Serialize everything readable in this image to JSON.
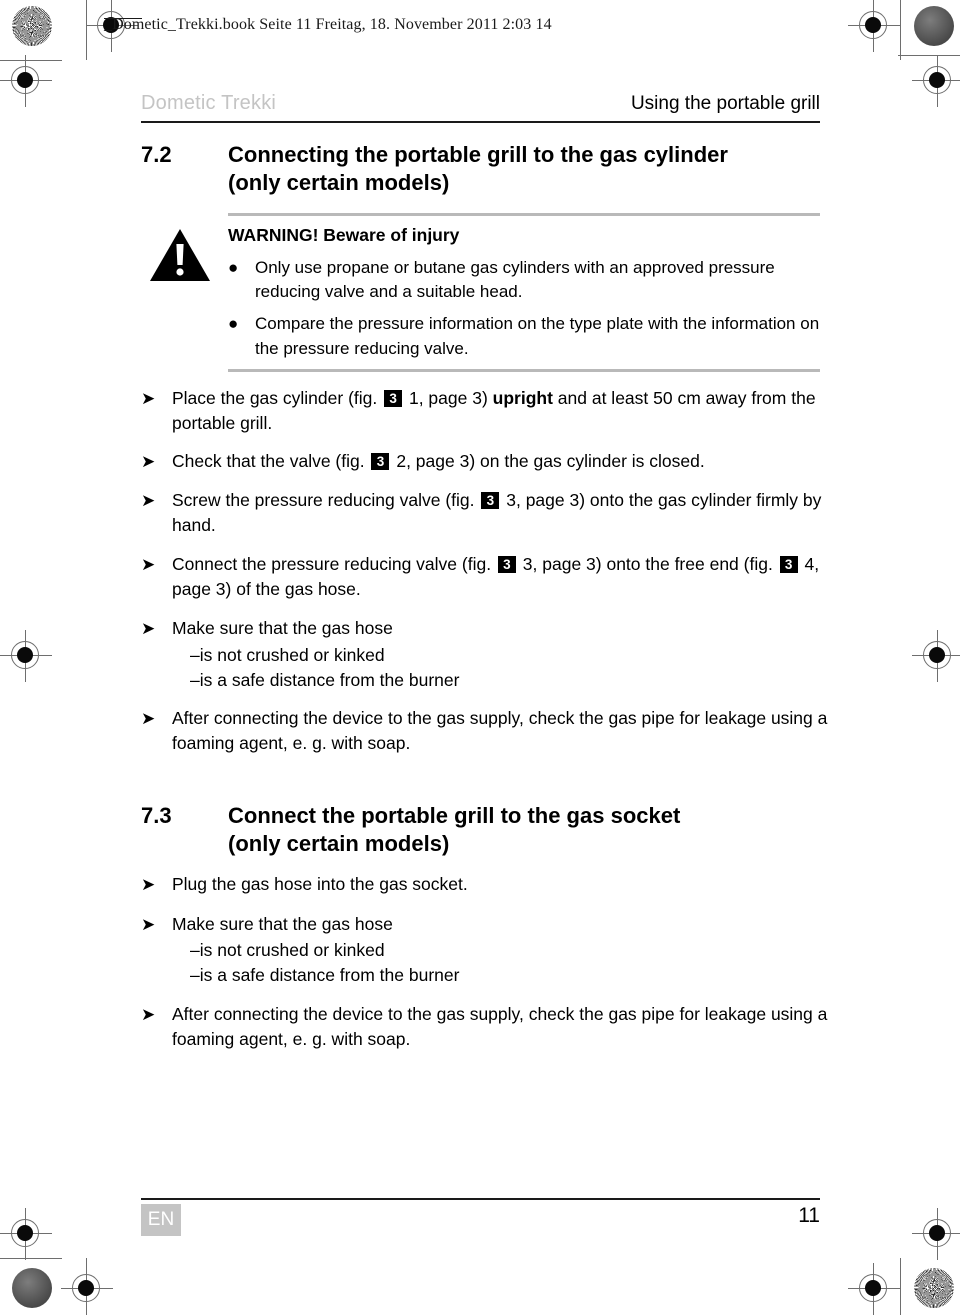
{
  "slug": {
    "text": "_Dometic_Trekki.book  Seite 11  Freitag, 18. November 2011  2:03 14"
  },
  "running_head": {
    "left": "Dometic Trekki",
    "right": "Using the portable grill",
    "left_color": "#c4c4c4"
  },
  "sections": [
    {
      "number": "7.2",
      "title_line1": "Connecting the portable grill to the gas cylinder",
      "title_line2": "(only certain models)"
    },
    {
      "number": "7.3",
      "title_line1": "Connect the portable grill to the gas socket",
      "title_line2": "(only certain models)"
    }
  ],
  "warning": {
    "icon": "warning-triangle-icon",
    "title": "WARNING! Beware of injury",
    "bullet_glyph": "●",
    "items": [
      "Only use propane or butane gas cylinders with an approved pressure reducing valve and a suitable head.",
      "Compare the pressure information on the type plate with the information on the pressure reducing valve."
    ]
  },
  "arrow_glyph": "➤",
  "dash_glyph": "–",
  "fig_badge_label": "3",
  "steps_72": [
    {
      "parts": [
        {
          "t": "text",
          "v": "Place the gas cylinder (fig. "
        },
        {
          "t": "badge",
          "v": "3"
        },
        {
          "t": "text",
          "v": " 1, page 3) "
        },
        {
          "t": "bold",
          "v": "upright"
        },
        {
          "t": "text",
          "v": " and at least 50 cm away from the portable grill."
        }
      ]
    },
    {
      "parts": [
        {
          "t": "text",
          "v": "Check that the valve (fig. "
        },
        {
          "t": "badge",
          "v": "3"
        },
        {
          "t": "text",
          "v": " 2, page 3) on the gas cylinder is closed."
        }
      ]
    },
    {
      "parts": [
        {
          "t": "text",
          "v": "Screw the pressure reducing valve (fig. "
        },
        {
          "t": "badge",
          "v": "3"
        },
        {
          "t": "text",
          "v": " 3, page 3) onto the gas cylinder firmly by hand."
        }
      ]
    },
    {
      "parts": [
        {
          "t": "text",
          "v": "Connect the pressure reducing valve (fig. "
        },
        {
          "t": "badge",
          "v": "3"
        },
        {
          "t": "text",
          "v": " 3, page 3) onto the free end (fig. "
        },
        {
          "t": "badge",
          "v": "3"
        },
        {
          "t": "text",
          "v": " 4, page 3) of the gas hose."
        }
      ]
    }
  ],
  "hose_check": {
    "lead": "Make sure that the gas hose",
    "sub_items": [
      "is not crushed or kinked",
      "is a safe distance from the burner"
    ]
  },
  "leak_check": "After connecting the device to the gas supply, check the gas pipe for leakage using a foaming agent, e. g. with soap.",
  "steps_73": [
    "Plug the gas hose into the gas socket."
  ],
  "footer": {
    "language": "EN",
    "page_number": "11",
    "badge_color": "#c4c4c4"
  }
}
